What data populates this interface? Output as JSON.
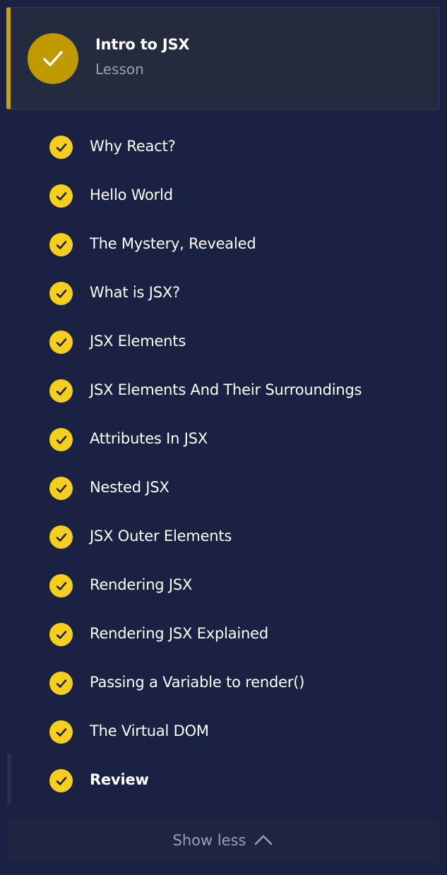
{
  "lesson": {
    "title": "Intro to JSX",
    "subtitle": "Lesson",
    "status_icon": "check-icon",
    "accent_color": "#c9a20a"
  },
  "items": [
    {
      "label": "Why React?",
      "completed": true
    },
    {
      "label": "Hello World",
      "completed": true
    },
    {
      "label": "The Mystery, Revealed",
      "completed": true
    },
    {
      "label": "What is JSX?",
      "completed": true
    },
    {
      "label": "JSX Elements",
      "completed": true
    },
    {
      "label": "JSX Elements And Their Surroundings",
      "completed": true
    },
    {
      "label": "Attributes In JSX",
      "completed": true
    },
    {
      "label": "Nested JSX",
      "completed": true
    },
    {
      "label": "JSX Outer Elements",
      "completed": true
    },
    {
      "label": "Rendering JSX",
      "completed": true
    },
    {
      "label": "Rendering JSX Explained",
      "completed": true
    },
    {
      "label": "Passing a Variable to render()",
      "completed": true
    },
    {
      "label": "The Virtual DOM",
      "completed": true
    },
    {
      "label": "Review",
      "completed": true,
      "current": true
    }
  ],
  "footer": {
    "toggle_label": "Show less",
    "toggle_icon": "chevron-up-icon"
  },
  "colors": {
    "background": "#1a2142",
    "check_fill": "#f5cf1c",
    "lesson_circle": "#bf9a00",
    "muted_text": "#9aa0b3"
  }
}
